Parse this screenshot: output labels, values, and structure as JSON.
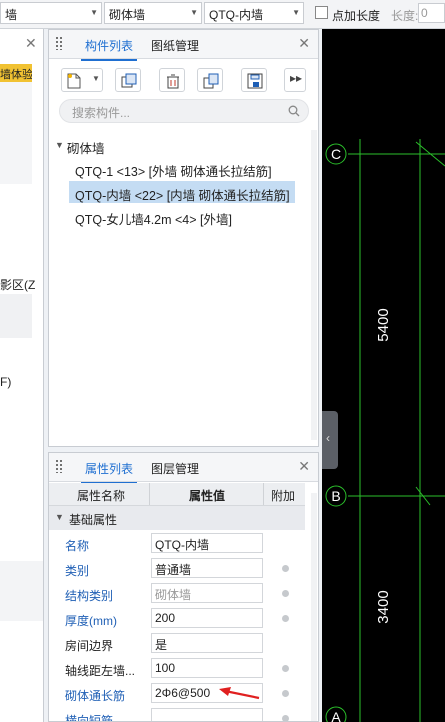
{
  "toolbar": {
    "combo1": "墙",
    "combo2": "砌体墙",
    "combo3": "QTQ-内墙",
    "checkbox_label": "点加长度",
    "length_label": "长度:",
    "length_value": "0"
  },
  "left_strip": {
    "badge": "墙体验",
    "text1": "影区(Z",
    "text2": "F)"
  },
  "component_panel": {
    "tabs": [
      "构件列表",
      "图纸管理"
    ],
    "search_placeholder": "搜索构件...",
    "group": "砌体墙",
    "items": [
      "QTQ-1 <13> [外墙 砌体通长拉结筋]",
      "QTQ-内墙 <22> [内墙 砌体通长拉结筋]",
      "QTQ-女儿墙4.2m <4> [外墙]"
    ],
    "selected_index": 1
  },
  "property_panel": {
    "tabs": [
      "属性列表",
      "图层管理"
    ],
    "headers": [
      "属性名称",
      "属性值",
      "附加"
    ],
    "group": "基础属性",
    "rows": [
      {
        "name": "名称",
        "value": "QTQ-内墙",
        "dot": false
      },
      {
        "name": "类别",
        "value": "普通墙",
        "dot": true
      },
      {
        "name": "结构类别",
        "value": "砌体墙",
        "dot": true
      },
      {
        "name": "厚度(mm)",
        "value": "200",
        "dot": true
      },
      {
        "name": "房间边界",
        "value": "是",
        "dot": false
      },
      {
        "name": "轴线距左墙...",
        "value": "100",
        "dot": true
      },
      {
        "name": "砌体通长筋",
        "value": "2Φ6@500",
        "dot": true
      },
      {
        "name": "横向短筋",
        "value": "",
        "dot": true
      }
    ]
  },
  "drawing": {
    "axis_c": "C",
    "axis_b": "B",
    "axis_a": "A",
    "dim1": "5400",
    "dim2": "3400",
    "line_color": "#2bbf2b"
  }
}
